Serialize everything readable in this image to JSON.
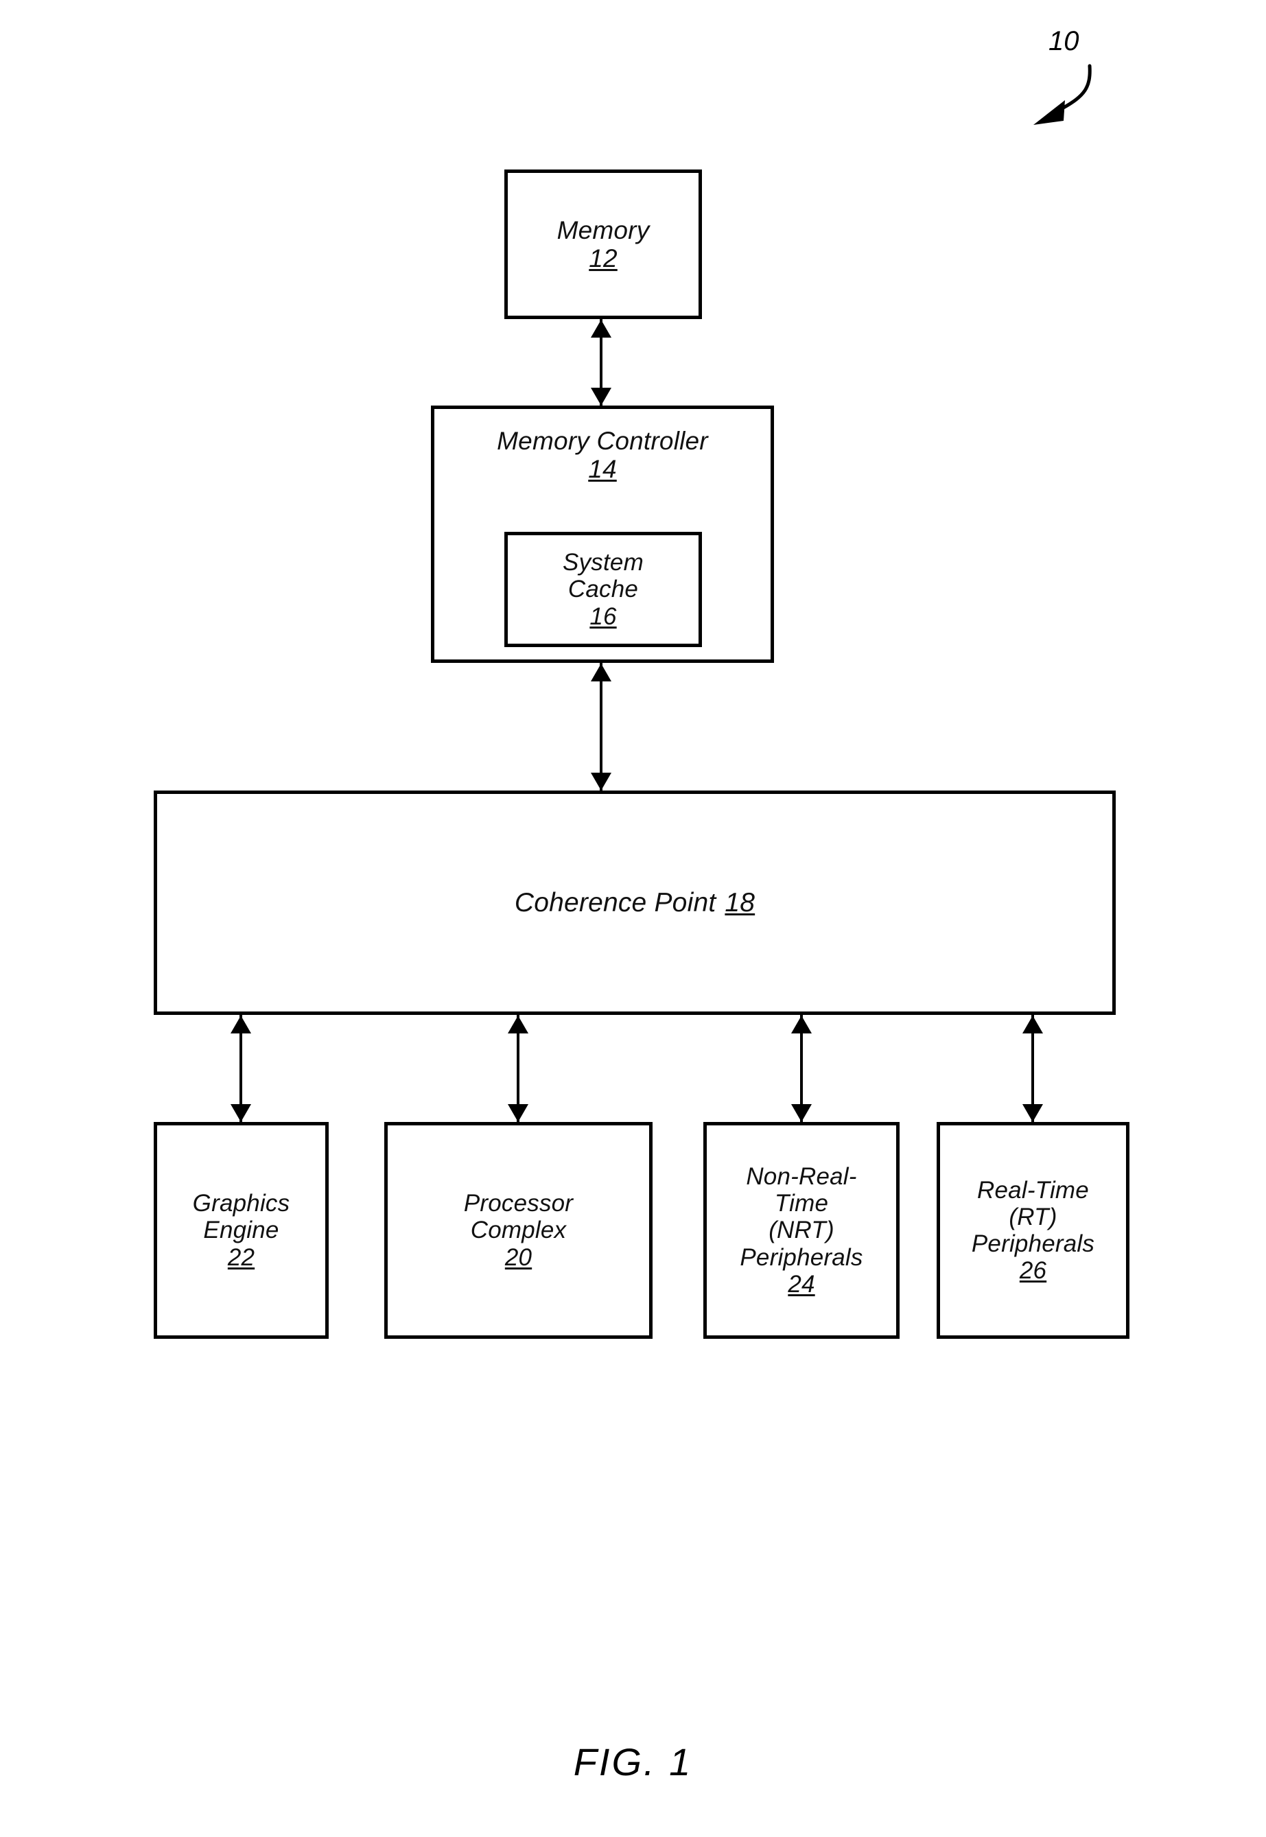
{
  "figure": {
    "caption": "FIG. 1",
    "system_reference": "10"
  },
  "nodes": {
    "memory": {
      "title": "Memory",
      "ref": "12"
    },
    "memctrl": {
      "title": "Memory Controller",
      "ref": "14"
    },
    "syscache": {
      "title": "System\nCache",
      "ref": "16"
    },
    "coherence": {
      "title": "Coherence Point",
      "ref": "18"
    },
    "gfx": {
      "title": "Graphics\nEngine",
      "ref": "22"
    },
    "cpu": {
      "title": "Processor\nComplex",
      "ref": "20"
    },
    "nrt": {
      "title": "Non-Real-\nTime\n(NRT)\nPeripherals",
      "ref": "24"
    },
    "rt": {
      "title": "Real-Time\n(RT)\nPeripherals",
      "ref": "26"
    }
  },
  "connections": [
    {
      "name": "memory-to-memory-controller",
      "from": "memory",
      "to": "memctrl",
      "style": "double-arrow"
    },
    {
      "name": "memory-controller-to-coherence",
      "from": "memctrl",
      "to": "coherence",
      "style": "double-arrow"
    },
    {
      "name": "coherence-to-graphics-engine",
      "from": "coherence",
      "to": "gfx",
      "style": "double-arrow"
    },
    {
      "name": "coherence-to-processor-complex",
      "from": "coherence",
      "to": "cpu",
      "style": "double-arrow"
    },
    {
      "name": "coherence-to-nrt-peripherals",
      "from": "coherence",
      "to": "nrt",
      "style": "double-arrow"
    },
    {
      "name": "coherence-to-rt-peripherals",
      "from": "coherence",
      "to": "rt",
      "style": "double-arrow"
    }
  ],
  "colors": {
    "ink": "#000000",
    "paper": "#ffffff"
  }
}
